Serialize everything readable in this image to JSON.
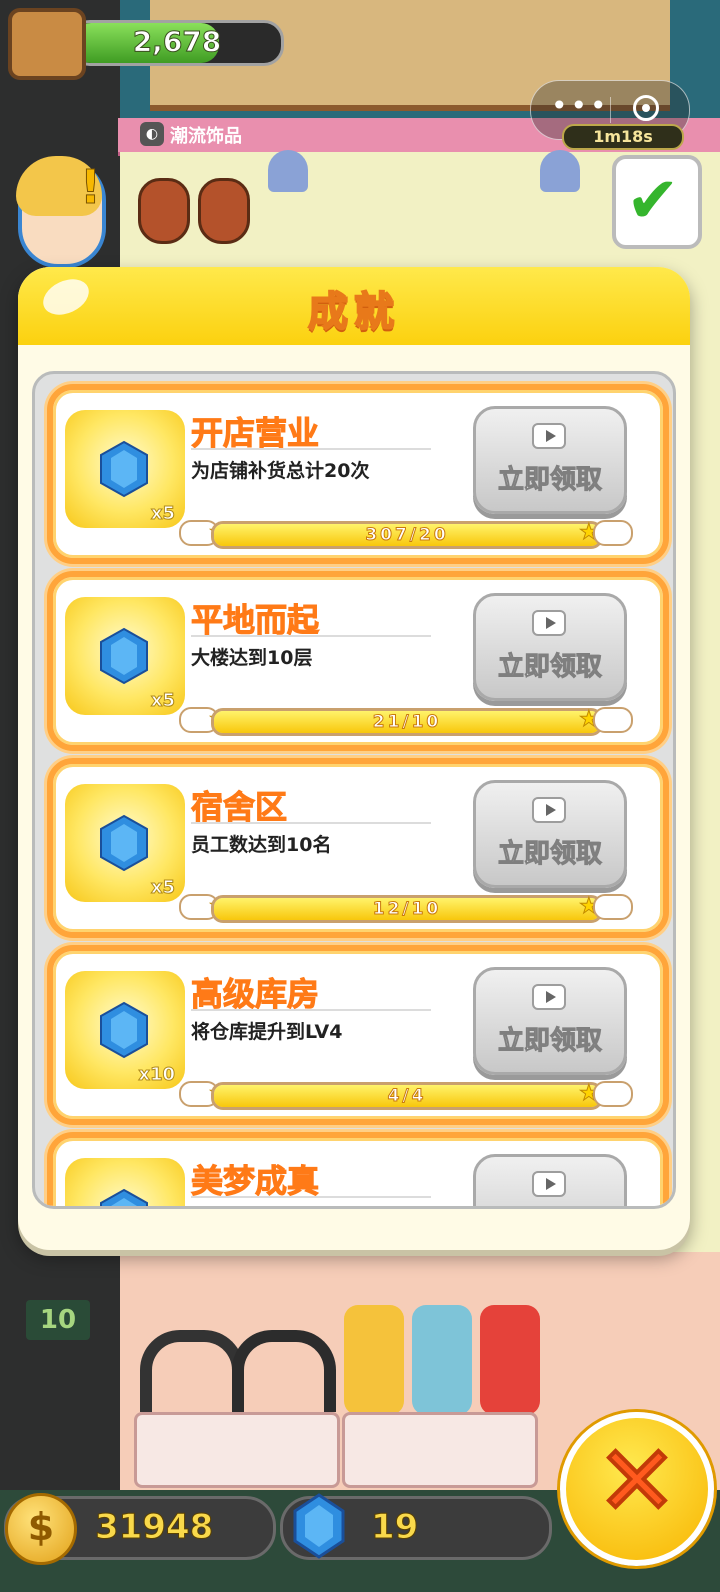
{
  "hud": {
    "box_count": "2,678",
    "timer": "1m18s",
    "shop_name": "潮流饰品",
    "elevator_floor": "10"
  },
  "dialog": {
    "title": "成就",
    "claim_label": "立即领取",
    "achievements": [
      {
        "title": "开店营业",
        "desc": "为店铺补货总计20次",
        "qty": "x5",
        "progress": "307/20",
        "progress_value": 1.0
      },
      {
        "title": "平地而起",
        "desc": "大楼达到10层",
        "qty": "x5",
        "progress": "21/10",
        "progress_value": 1.0
      },
      {
        "title": "宿舍区",
        "desc": "员工数达到10名",
        "qty": "x5",
        "progress": "12/10",
        "progress_value": 1.0
      },
      {
        "title": "高级库房",
        "desc": "将仓库提升到LV4",
        "qty": "x10",
        "progress": "4/4",
        "progress_value": 1.0
      },
      {
        "title": "美梦成真",
        "desc": "",
        "qty": "",
        "progress": "",
        "progress_value": 0
      }
    ]
  },
  "bottom": {
    "coins": "31948",
    "gems": "19",
    "coin_icon": "$"
  },
  "colors": {
    "accent_orange": "#ff7a17",
    "header_yellow": "#fbd10f",
    "gem_blue": "#2f8ee0"
  }
}
